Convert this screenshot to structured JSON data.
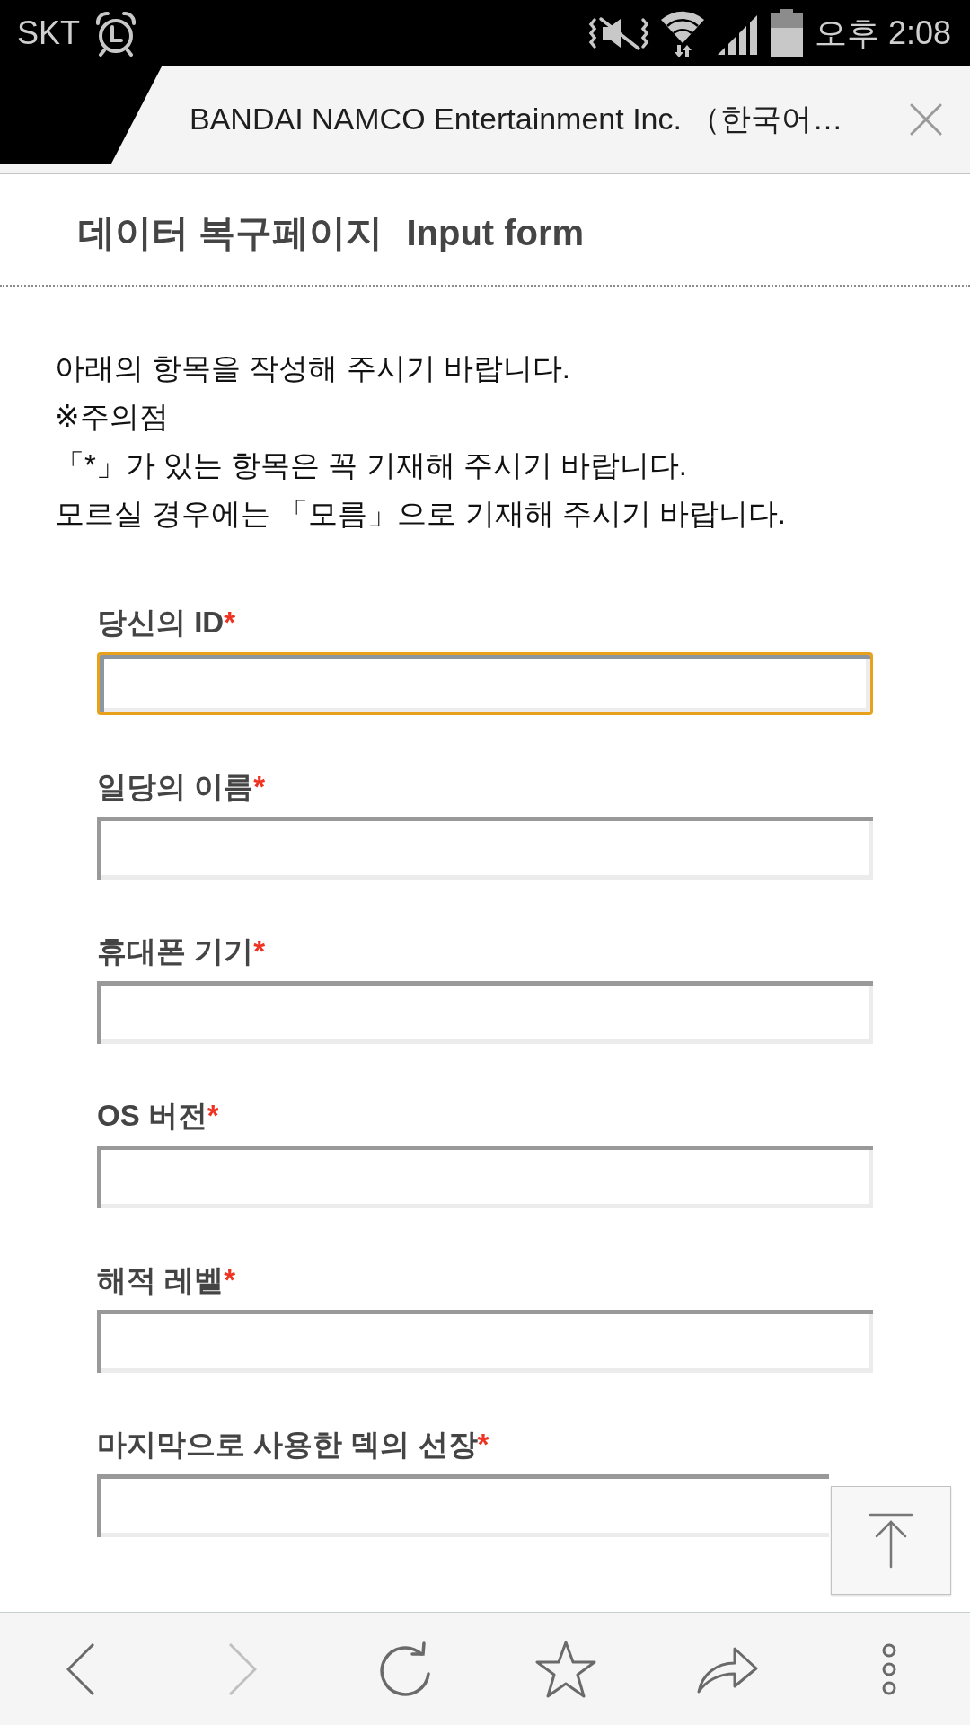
{
  "status_bar": {
    "carrier": "SKT",
    "time": "오후 2:08"
  },
  "browser_tab": {
    "title": "BANDAI NAMCO Entertainment Inc. （한국어…"
  },
  "page": {
    "title": "데이터 복구페이지",
    "subtitle": "Input form",
    "intro_lines": [
      "아래의 항목을 작성해 주시기 바랍니다.",
      "※주의점",
      "「*」가 있는 항목은 꼭 기재해 주시기 바랍니다.",
      "모르실 경우에는 「모름」으로 기재해 주시기 바랍니다."
    ]
  },
  "form": {
    "fields": [
      {
        "label": "당신의 ID",
        "required_mark": "*",
        "focused": true
      },
      {
        "label": "일당의 이름",
        "required_mark": "*",
        "focused": false
      },
      {
        "label": "휴대폰 기기",
        "required_mark": "*",
        "focused": false
      },
      {
        "label": "OS 버전",
        "required_mark": "*",
        "focused": false
      },
      {
        "label": "해적 레벨",
        "required_mark": "*",
        "focused": false
      },
      {
        "label": "마지막으로 사용한 덱의 선장",
        "required_mark": "*",
        "focused": false
      }
    ]
  },
  "toolbar": {
    "buttons": [
      {
        "kind": "back",
        "disabled": false
      },
      {
        "kind": "forward",
        "disabled": true
      },
      {
        "kind": "reload",
        "disabled": false
      },
      {
        "kind": "bookmark",
        "disabled": false
      },
      {
        "kind": "share",
        "disabled": false
      },
      {
        "kind": "menu",
        "disabled": false
      }
    ]
  }
}
